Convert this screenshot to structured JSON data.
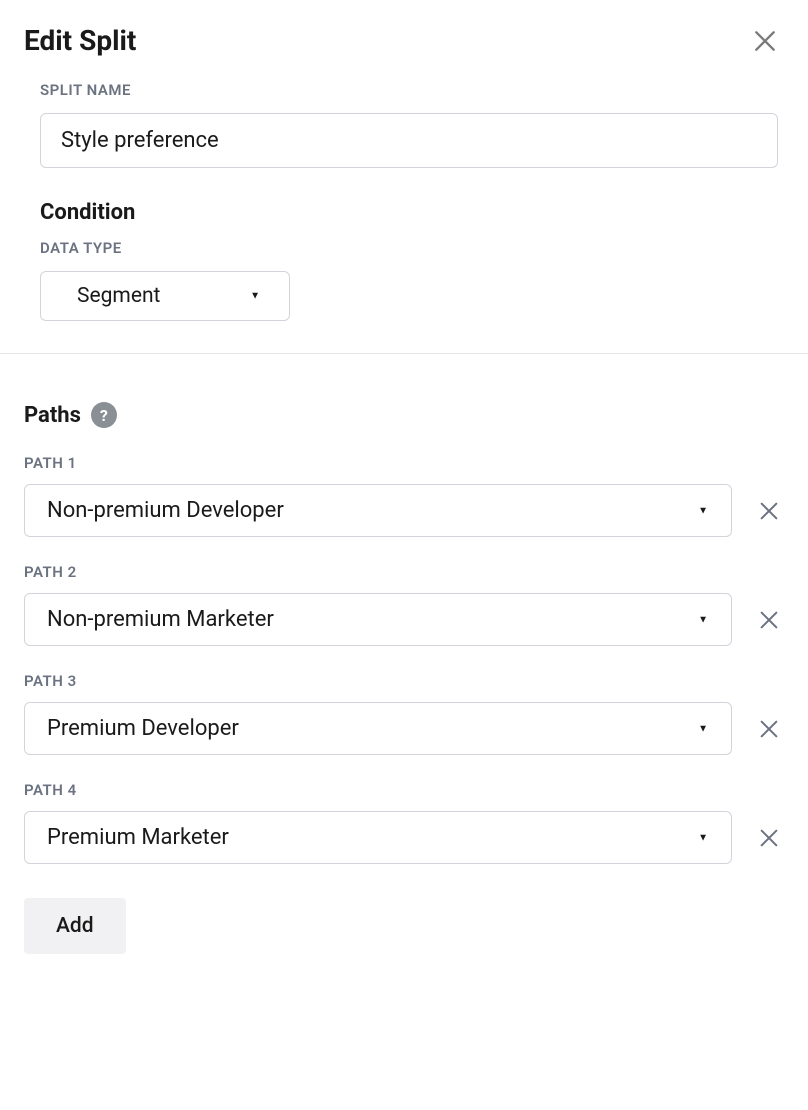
{
  "header": {
    "title": "Edit Split"
  },
  "splitName": {
    "label": "SPLIT NAME",
    "value": "Style preference"
  },
  "condition": {
    "heading": "Condition",
    "dataTypeLabel": "DATA TYPE",
    "dataTypeValue": "Segment"
  },
  "paths": {
    "heading": "Paths",
    "helpSymbol": "?",
    "items": [
      {
        "label": "PATH 1",
        "value": "Non-premium Developer"
      },
      {
        "label": "PATH 2",
        "value": "Non-premium Marketer"
      },
      {
        "label": "PATH 3",
        "value": "Premium Developer"
      },
      {
        "label": "PATH 4",
        "value": "Premium Marketer"
      }
    ],
    "addLabel": "Add"
  }
}
